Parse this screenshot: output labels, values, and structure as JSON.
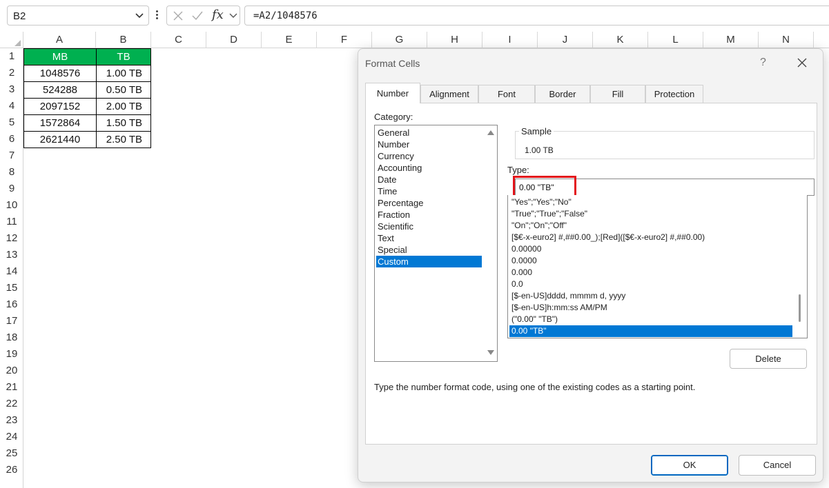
{
  "formula_bar": {
    "name_box": "B2",
    "fx_label": "fx",
    "formula": "=A2/1048576"
  },
  "grid": {
    "columns": [
      "A",
      "B",
      "C",
      "D",
      "E",
      "F",
      "G",
      "H",
      "I",
      "J",
      "K",
      "L",
      "M",
      "N"
    ],
    "rows": [
      "1",
      "2",
      "3",
      "4",
      "5",
      "6",
      "7",
      "8",
      "9",
      "10",
      "11",
      "12",
      "13",
      "14",
      "15",
      "16",
      "17",
      "18",
      "19",
      "20",
      "21",
      "22",
      "23",
      "24",
      "25",
      "26"
    ],
    "header": {
      "mb": "MB",
      "tb": "TB"
    },
    "data": [
      {
        "mb": "1048576",
        "tb": "1.00 TB"
      },
      {
        "mb": "524288",
        "tb": "0.50 TB"
      },
      {
        "mb": "2097152",
        "tb": "2.00 TB"
      },
      {
        "mb": "1572864",
        "tb": "1.50 TB"
      },
      {
        "mb": "2621440",
        "tb": "2.50 TB"
      }
    ],
    "header_color": "#00b050"
  },
  "dialog": {
    "title": "Format Cells",
    "help": "?",
    "tabs": [
      "Number",
      "Alignment",
      "Font",
      "Border",
      "Fill",
      "Protection"
    ],
    "active_tab": "Number",
    "category_label": "Category:",
    "categories": [
      "General",
      "Number",
      "Currency",
      "Accounting",
      "Date",
      "Time",
      "Percentage",
      "Fraction",
      "Scientific",
      "Text",
      "Special",
      "Custom"
    ],
    "selected_category": "Custom",
    "sample_label": "Sample",
    "sample_value": "1.00 TB",
    "type_label": "Type:",
    "type_value": "0.00 \"TB\"",
    "formats": [
      "\"Yes\";\"Yes\";\"No\"",
      "\"True\";\"True\";\"False\"",
      "\"On\";\"On\";\"Off\"",
      "[$€-x-euro2] #,##0.00_);[Red]([$€-x-euro2] #,##0.00)",
      "0.00000",
      "0.0000",
      "0.000",
      "0.0",
      "[$-en-US]dddd, mmmm d, yyyy",
      "[$-en-US]h:mm:ss AM/PM",
      "(\"0.00\" \"TB\")",
      "0.00 \"TB\""
    ],
    "selected_format": "0.00 \"TB\"",
    "delete_label": "Delete",
    "description": "Type the number format code, using one of the existing codes as a starting point.",
    "ok_label": "OK",
    "cancel_label": "Cancel",
    "accent": "#0078d4",
    "highlight_color": "#e3141b"
  }
}
